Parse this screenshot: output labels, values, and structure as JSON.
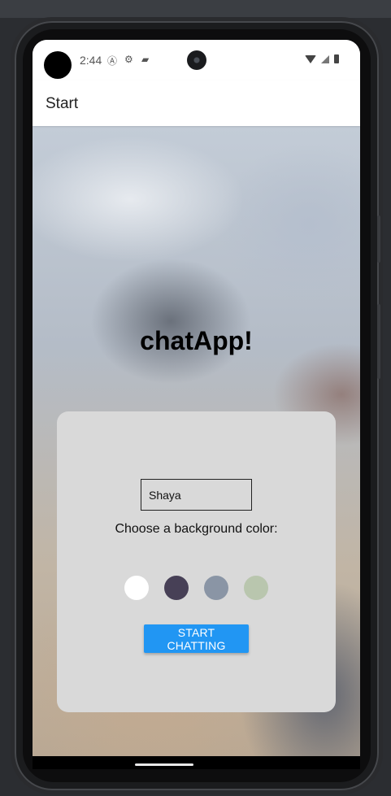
{
  "status_bar": {
    "time": "2:44"
  },
  "app_bar": {
    "title": "Start"
  },
  "main": {
    "app_title": "chatApp!",
    "name_input": {
      "value": "Shaya",
      "placeholder": ""
    },
    "color_prompt": "Choose a background color:",
    "color_options": [
      {
        "name": "white",
        "hex": "#FFFFFF"
      },
      {
        "name": "dark-purple",
        "hex": "#474056"
      },
      {
        "name": "slate",
        "hex": "#8A95A5"
      },
      {
        "name": "sage",
        "hex": "#B9C6AE"
      }
    ],
    "start_button_label": "START CHATTING"
  },
  "colors": {
    "accent": "#2196F3",
    "card_background": "#D9D9D9"
  },
  "icons": [
    "a-circle-icon",
    "gear-s-icon",
    "sd-card-icon",
    "wifi-icon",
    "signal-icon",
    "battery-icon"
  ]
}
